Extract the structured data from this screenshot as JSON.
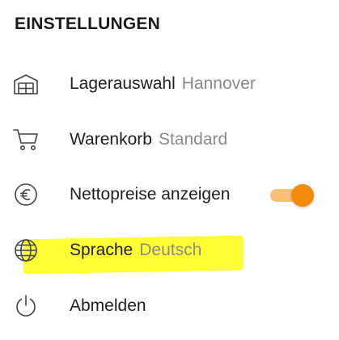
{
  "settings": {
    "title": "EINSTELLUNGEN",
    "items": [
      {
        "label": "Lagerauswahl",
        "value": "Hannover",
        "icon": "warehouse-icon"
      },
      {
        "label": "Warenkorb",
        "value": "Standard",
        "icon": "cart-icon"
      },
      {
        "label": "Nettopreise anzeigen",
        "icon": "euro-icon",
        "toggle_on": true
      },
      {
        "label": "Sprache",
        "value": "Deutsch",
        "icon": "globe-icon",
        "highlighted": true
      },
      {
        "label": "Abmelden",
        "icon": "power-icon"
      }
    ]
  },
  "colors": {
    "toggle_track": "#f7c179",
    "toggle_thumb": "#f28a0c",
    "highlight": "#ffff33",
    "value_text": "#8a8a8a"
  }
}
